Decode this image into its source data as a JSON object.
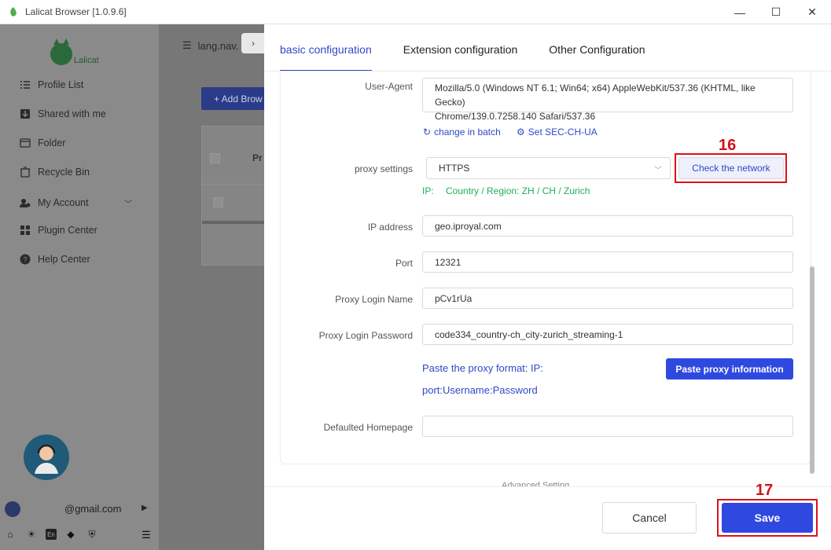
{
  "window": {
    "title": "Lalicat Browser  [1.0.9.6]",
    "controls": {
      "minimize": "—",
      "maximize": "☐",
      "close": "✕"
    }
  },
  "sidebar": {
    "brand": "Lalicat",
    "items": [
      {
        "label": "Profile List",
        "icon": "list-icon"
      },
      {
        "label": "Shared with me",
        "icon": "download-icon"
      },
      {
        "label": "Folder",
        "icon": "folder-icon"
      },
      {
        "label": "Recycle Bin",
        "icon": "trash-icon"
      },
      {
        "label": "My Account",
        "icon": "account-icon"
      },
      {
        "label": "Plugin Center",
        "icon": "plugin-icon"
      },
      {
        "label": "Help Center",
        "icon": "help-icon"
      }
    ],
    "email": "@gmail.com",
    "language": "En"
  },
  "background": {
    "tab_label": "lang.nav.",
    "add_button": "+ Add Brow",
    "table_col": "Pr"
  },
  "drawer": {
    "tabs": [
      "basic configuration",
      "Extension configuration",
      "Other Configuration"
    ],
    "user_agent": {
      "label": "User-Agent",
      "value_line1": "Mozilla/5.0 (Windows NT 6.1; Win64; x64) AppleWebKit/537.36 (KHTML, like Gecko)",
      "value_line2": "Chrome/139.0.7258.140 Safari/537.36"
    },
    "change_batch": "change in batch",
    "set_sec": "Set SEC-CH-UA",
    "proxy": {
      "label": "proxy settings",
      "value": "HTTPS",
      "check_button": "Check the network",
      "ip_prefix": "IP:",
      "ip_info": "Country / Region: ZH / CH / Zurich"
    },
    "ip_address": {
      "label": "IP address",
      "value": "geo.iproyal.com"
    },
    "port": {
      "label": "Port",
      "value": "12321"
    },
    "login_name": {
      "label": "Proxy Login Name",
      "value": "pCv1rUa"
    },
    "login_password": {
      "label": "Proxy Login Password",
      "value": "code334_country-ch_city-zurich_streaming-1"
    },
    "paste_hint_line1": "Paste the proxy format: IP:",
    "paste_hint_line2": "port:Username:Password",
    "paste_button": "Paste proxy information",
    "homepage": {
      "label": "Defaulted Homepage",
      "value": ""
    },
    "advanced": "Advanced Setting",
    "cancel": "Cancel",
    "save": "Save"
  },
  "annotations": {
    "step1": "16",
    "step2": "17",
    "color": "#e0101a"
  }
}
